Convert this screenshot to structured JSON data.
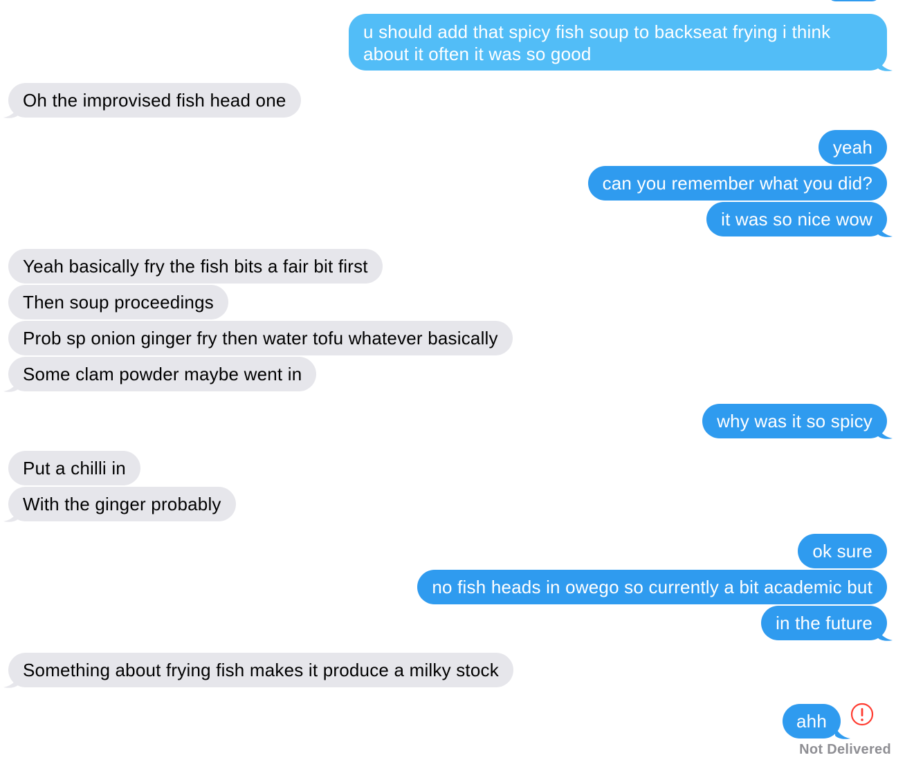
{
  "conversation": {
    "messages": [
      {
        "text": "u should add that spicy fish soup to backseat frying i think about it often it was so good"
      },
      {
        "text": "Oh the improvised fish head one"
      },
      {
        "text": "yeah"
      },
      {
        "text": "can you remember what you did?"
      },
      {
        "text": "it was so nice wow"
      },
      {
        "text": "Yeah basically fry the fish bits a fair bit first"
      },
      {
        "text": "Then soup proceedings"
      },
      {
        "text": "Prob sp onion ginger fry then water tofu whatever basically"
      },
      {
        "text": "Some clam powder maybe went in"
      },
      {
        "text": "why was it so spicy"
      },
      {
        "text": "Put a chilli in"
      },
      {
        "text": "With the ginger probably"
      },
      {
        "text": "ok sure"
      },
      {
        "text": "no fish heads in owego so currently a bit academic but"
      },
      {
        "text": "in the future"
      },
      {
        "text": "Something about frying fish makes it produce a milky stock"
      },
      {
        "text": "ahh"
      }
    ],
    "delivery_status": "Not Delivered"
  },
  "icons": {
    "error": "exclamation-circle-icon"
  },
  "colors": {
    "sent_bubble": "#2f9bef",
    "sent_bubble_light": "#52bdf7",
    "received_bubble": "#e6e6eb",
    "error_red": "#ff3b30",
    "status_gray": "#8e8e93"
  }
}
